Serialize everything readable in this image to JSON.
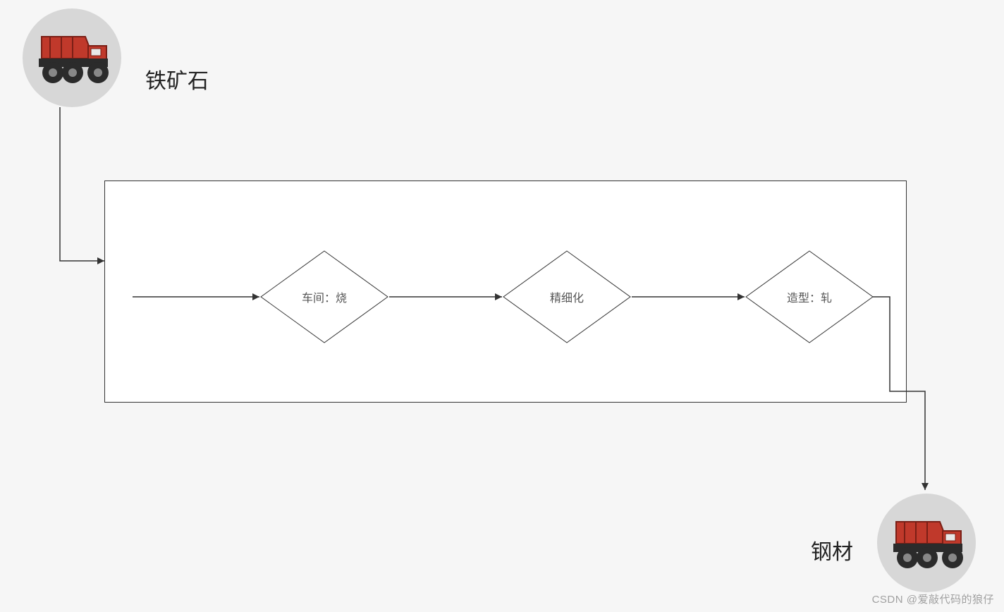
{
  "input": {
    "label": "铁矿石"
  },
  "output": {
    "label": "钢材"
  },
  "steps": {
    "step1": "车间：烧",
    "step2": "精细化",
    "step3": "造型：轧"
  },
  "watermark": "CSDN @爱敲代码的狼仔",
  "colors": {
    "background": "#f6f6f6",
    "circle": "#d7d7d7",
    "stroke": "#333333",
    "truck_red": "#c0392b",
    "truck_dark": "#2b2b2b"
  }
}
